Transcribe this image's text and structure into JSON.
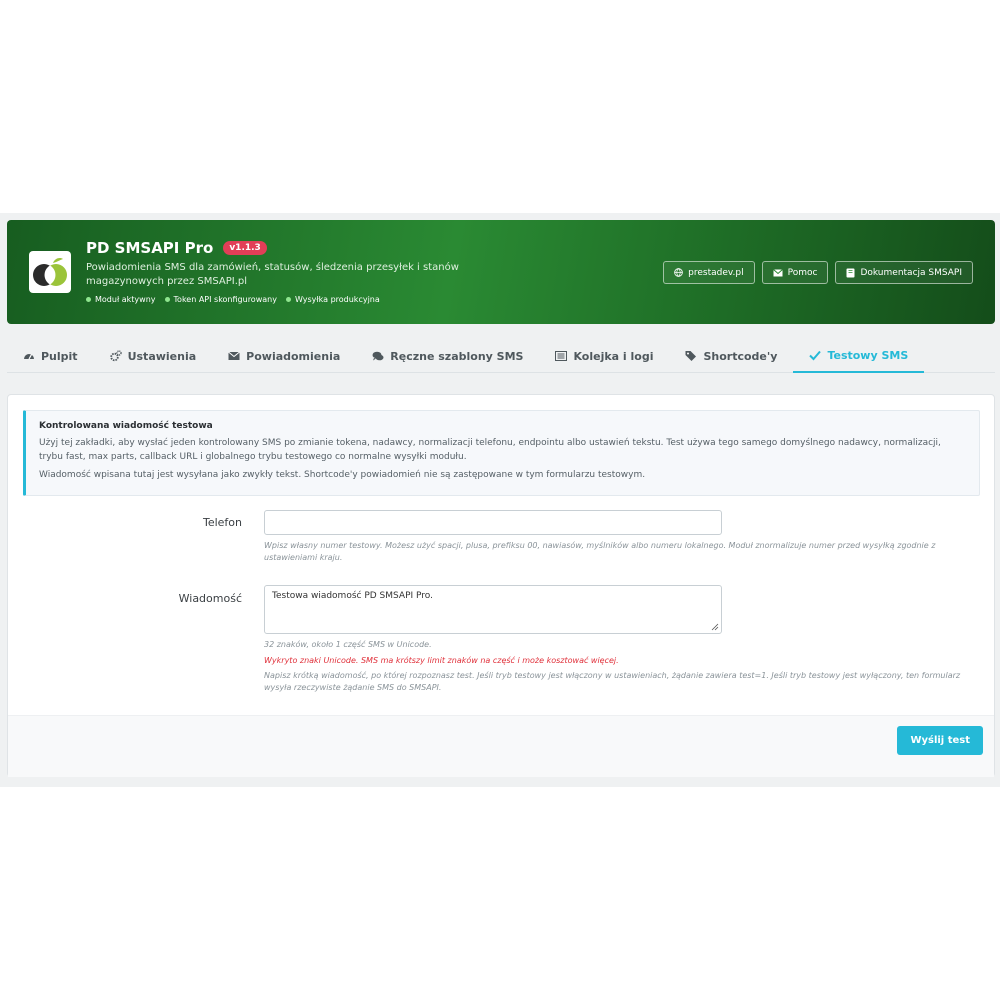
{
  "header": {
    "title": "PD SMSAPI Pro",
    "version": "v1.1.3",
    "subtitle": "Powiadomienia SMS dla zamówień, statusów, śledzenia przesyłek i stanów magazynowych przez SMSAPI.pl",
    "statuses": [
      "Moduł aktywny",
      "Token API skonfigurowany",
      "Wysyłka produkcyjna"
    ],
    "buttons": {
      "site": "prestadev.pl",
      "help": "Pomoc",
      "docs": "Dokumentacja SMSAPI"
    }
  },
  "tabs": [
    {
      "label": "Pulpit",
      "icon": "dashboard-icon"
    },
    {
      "label": "Ustawienia",
      "icon": "gears-icon"
    },
    {
      "label": "Powiadomienia",
      "icon": "envelope-icon"
    },
    {
      "label": "Ręczne szablony SMS",
      "icon": "comments-icon"
    },
    {
      "label": "Kolejka i logi",
      "icon": "list-icon"
    },
    {
      "label": "Shortcode'y",
      "icon": "tags-icon"
    },
    {
      "label": "Testowy SMS",
      "icon": "check-icon",
      "active": true
    }
  ],
  "alert": {
    "title": "Kontrolowana wiadomość testowa",
    "text1": "Użyj tej zakładki, aby wysłać jeden kontrolowany SMS po zmianie tokena, nadawcy, normalizacji telefonu, endpointu albo ustawień tekstu. Test używa tego samego domyślnego nadawcy, normalizacji, trybu fast, max parts, callback URL i globalnego trybu testowego co normalne wysyłki modułu.",
    "text2": "Wiadomość wpisana tutaj jest wysyłana jako zwykły tekst. Shortcode'y powiadomień nie są zastępowane w tym formularzu testowym."
  },
  "form": {
    "phone_label": "Telefon",
    "phone_value": "",
    "phone_help": "Wpisz własny numer testowy. Możesz użyć spacji, plusa, prefiksu 00, nawiasów, myślników albo numeru lokalnego. Moduł znormalizuje numer przed wysyłką zgodnie z ustawieniami kraju.",
    "message_label": "Wiadomość",
    "message_value": "Testowa wiadomość PD SMSAPI Pro.",
    "counter": "32 znaków, około 1 część SMS w Unicode.",
    "unicode_warning": "Wykryto znaki Unicode. SMS ma krótszy limit znaków na część i może kosztować więcej.",
    "message_help": "Napisz krótką wiadomość, po której rozpoznasz test. Jeśli tryb testowy jest włączony w ustawieniach, żądanie zawiera test=1. Jeśli tryb testowy jest wyłączony, ten formularz wysyła rzeczywiste żądanie SMS do SMSAPI."
  },
  "submit_label": "Wyślij test",
  "colors": {
    "accent": "#25b9d7",
    "header_green": "#2a8a33",
    "version_badge": "#e23e57",
    "warning": "#e0303a"
  }
}
